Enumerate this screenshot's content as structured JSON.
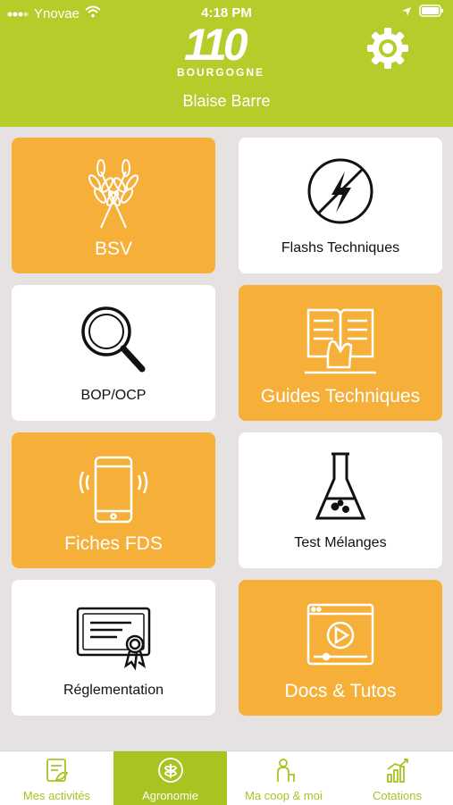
{
  "status_bar": {
    "carrier": "Ynovae",
    "time": "4:18 PM"
  },
  "header": {
    "logo_number": "110",
    "logo_region": "BOURGOGNE",
    "user_name": "Blaise Barre"
  },
  "tiles": [
    {
      "label": "BSV",
      "icon": "wheat-icon",
      "style": "orange"
    },
    {
      "label": "Flashs Techniques",
      "icon": "lightning-circle-icon",
      "style": "white"
    },
    {
      "label": "BOP/OCP",
      "icon": "magnifier-icon",
      "style": "white"
    },
    {
      "label": "Guides Techniques",
      "icon": "book-hand-icon",
      "style": "orange"
    },
    {
      "label": "Fiches FDS",
      "icon": "smartphone-icon",
      "style": "orange"
    },
    {
      "label": "Test Mélanges",
      "icon": "flask-icon",
      "style": "white"
    },
    {
      "label": "Réglementation",
      "icon": "certificate-icon",
      "style": "white"
    },
    {
      "label": "Docs & Tutos",
      "icon": "video-player-icon",
      "style": "orange"
    }
  ],
  "tabbar": {
    "items": [
      {
        "label": "Mes activités",
        "icon": "activities-icon",
        "active": false
      },
      {
        "label": "Agronomie",
        "icon": "leaf-icon",
        "active": true
      },
      {
        "label": "Ma coop & moi",
        "icon": "coop-icon",
        "active": false
      },
      {
        "label": "Cotations",
        "icon": "chart-icon",
        "active": false
      }
    ]
  },
  "colors": {
    "brand_green": "#b5cc2b",
    "tab_green": "#a9c321",
    "tile_orange": "#f6b03a",
    "background": "#e7e2e2"
  }
}
